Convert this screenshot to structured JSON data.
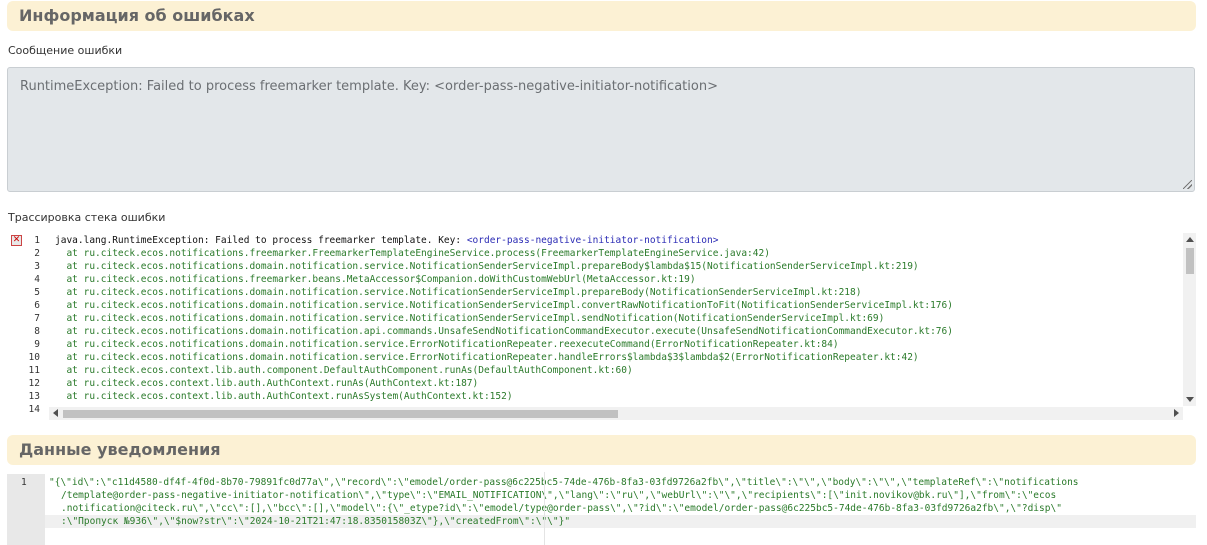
{
  "sections": {
    "error_info_title": "Информация об ошибках",
    "notification_data_title": "Данные уведомления"
  },
  "error_message": {
    "label": "Сообщение ошибки",
    "value": "RuntimeException: Failed to process freemarker template. Key: <order-pass-negative-initiator-notification>"
  },
  "stack_trace": {
    "label": "Трассировка стека ошибки",
    "line_numbers": [
      "1",
      "2",
      "3",
      "4",
      "5",
      "6",
      "7",
      "8",
      "9",
      "10",
      "11",
      "12",
      "13",
      "14"
    ],
    "first_line_prefix": "java.lang.RuntimeException: Failed to process freemarker template. Key: ",
    "first_line_key": "<order-pass-negative-initiator-notification>",
    "lines": [
      "  at ru.citeck.ecos.notifications.freemarker.FreemarkerTemplateEngineService.process(FreemarkerTemplateEngineService.java:42)",
      "  at ru.citeck.ecos.notifications.domain.notification.service.NotificationSenderServiceImpl.prepareBody$lambda$15(NotificationSenderServiceImpl.kt:219)",
      "  at ru.citeck.ecos.notifications.freemarker.beans.MetaAccessor$Companion.doWithCustomWebUrl(MetaAccessor.kt:19)",
      "  at ru.citeck.ecos.notifications.domain.notification.service.NotificationSenderServiceImpl.prepareBody(NotificationSenderServiceImpl.kt:218)",
      "  at ru.citeck.ecos.notifications.domain.notification.service.NotificationSenderServiceImpl.convertRawNotificationToFit(NotificationSenderServiceImpl.kt:176)",
      "  at ru.citeck.ecos.notifications.domain.notification.service.NotificationSenderServiceImpl.sendNotification(NotificationSenderServiceImpl.kt:69)",
      "  at ru.citeck.ecos.notifications.domain.notification.api.commands.UnsafeSendNotificationCommandExecutor.execute(UnsafeSendNotificationCommandExecutor.kt:76)",
      "  at ru.citeck.ecos.notifications.domain.notification.service.ErrorNotificationRepeater.reexecuteCommand(ErrorNotificationRepeater.kt:84)",
      "  at ru.citeck.ecos.notifications.domain.notification.service.ErrorNotificationRepeater.handleErrors$lambda$3$lambda$2(ErrorNotificationRepeater.kt:42)",
      "  at ru.citeck.ecos.context.lib.auth.component.DefaultAuthComponent.runAs(DefaultAuthComponent.kt:60)",
      "  at ru.citeck.ecos.context.lib.auth.AuthContext.runAs(AuthContext.kt:187)",
      "  at ru.citeck.ecos.context.lib.auth.AuthContext.runAsSystem(AuthContext.kt:152)"
    ]
  },
  "notification_data": {
    "line_number": "1",
    "lines": [
      "\"{\\\"id\\\":\\\"c11d4580-df4f-4f0d-8b70-79891fc0d77a\\\",\\\"record\\\":\\\"emodel/order-pass@6c225bc5-74de-476b-8fa3-03fd9726a2fb\\\",\\\"title\\\":\\\"\\\",\\\"body\\\":\\\"\\\",\\\"templateRef\\\":\\\"notifications",
      "/template@order-pass-negative-initiator-notification\\\",\\\"type\\\":\\\"EMAIL_NOTIFICATION\\\",\\\"lang\\\":\\\"ru\\\",\\\"webUrl\\\":\\\"\\\",\\\"recipients\\\":[\\\"init.novikov@bk.ru\\\"],\\\"from\\\":\\\"ecos",
      ".notification@citeck.ru\\\",\\\"cc\\\":[],\\\"bcc\\\":[],\\\"model\\\":{\\\"_etype?id\\\":\\\"emodel/type@order-pass\\\",\\\"?id\\\":\\\"emodel/order-pass@6c225bc5-74de-476b-8fa3-03fd9726a2fb\\\",\\\"?disp\\\"",
      ":\\\"Пропуск №936\\\",\\\"$now?str\\\":\\\"2024-10-21T21:47:18.835015803Z\\\"},\\\"createdFrom\\\":\\\"\\\"}\""
    ]
  }
}
